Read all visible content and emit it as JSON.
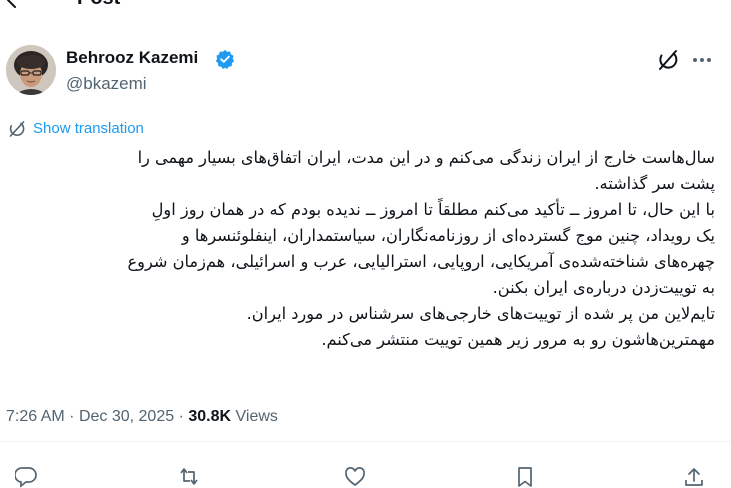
{
  "header": {
    "title": "Post",
    "back_icon": "back-arrow-icon"
  },
  "author": {
    "name": "Behrooz Kazemi",
    "handle": "@bkazemi",
    "verified": true,
    "verified_color": "#1d9bf0"
  },
  "actions": {
    "grok_icon": "grok-icon",
    "more_icon": "more-dots-icon"
  },
  "translation": {
    "label": "Show translation",
    "color": "#1d9bf0"
  },
  "tweet": {
    "lines": [
      "سال‌هاست خارج از ایران زندگی می‌کنم و در این مدت، ایران اتفاق‌های بسیار مهمی را",
      "پشت سر گذاشته.",
      "با این حال، تا امروز ــ تأکید می‌کنم مطلقاً تا امروز ــ ندیده بودم که در همان روز اولِ",
      "یک رویداد، چنین موج گسترده‌ای از روزنامه‌نگاران، سیاستمداران، اینفلوئنسرها و",
      "چهره‌های شناخته‌شده‌ی آمریکایی، اروپایی، استرالیایی، عرب و اسرائیلی، هم‌زمان شروع",
      "به توییت‌زدن درباره‌ی ایران بکنن.",
      "تایم‌لاین من پر شده از توییت‌های خارجی‌های سرشناس در مورد ایران.",
      "مهمترین‌هاشون رو به مرور زیر همین توییت منتشر می‌کنم."
    ]
  },
  "meta": {
    "time": "7:26 AM",
    "date": "Dec 30, 2025",
    "separator": "·",
    "views_count": "30.8K",
    "views_label": "Views"
  },
  "engagement_bar": {
    "icons": [
      "reply-icon",
      "repost-icon",
      "like-icon",
      "bookmark-icon",
      "share-icon"
    ]
  },
  "colors": {
    "text_primary": "#0f1419",
    "text_secondary": "#536471",
    "accent": "#1d9bf0",
    "divider": "#eff3f4"
  }
}
